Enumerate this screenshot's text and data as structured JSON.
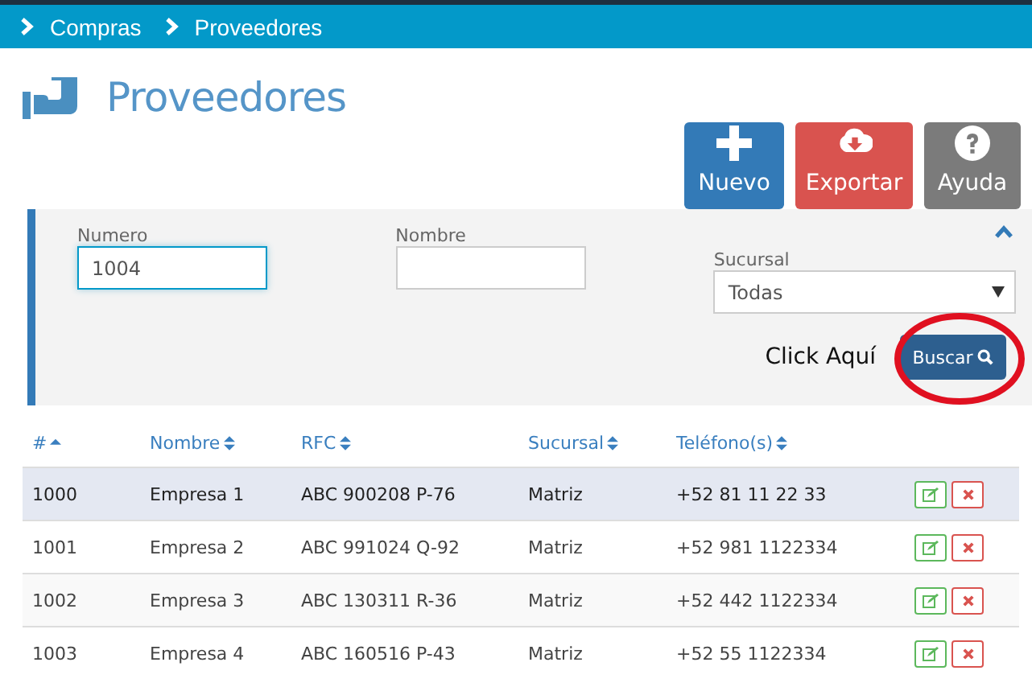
{
  "breadcrumb": [
    "Compras",
    "Proveedores"
  ],
  "page_title": "Proveedores",
  "actions": [
    {
      "kind": "new",
      "label": "Nuevo"
    },
    {
      "kind": "export",
      "label": "Exportar"
    },
    {
      "kind": "help",
      "label": "Ayuda"
    }
  ],
  "filters": {
    "expanded": true,
    "fields": [
      {
        "label": "Numero",
        "value": "1004",
        "focused": true
      },
      {
        "label": "Nombre",
        "focused": false
      }
    ],
    "sucursal": {
      "label": "Sucursal",
      "value": "Todas"
    },
    "hint": "Click Aquí",
    "search_button": "Buscar"
  },
  "table": {
    "columns": [
      {
        "label": "#",
        "sorted": true
      },
      {
        "label": "Nombre",
        "sorted": false
      },
      {
        "label": "RFC",
        "sorted": false
      },
      {
        "label": "Sucursal",
        "sorted": false
      },
      {
        "label": "Teléfono(s)",
        "sorted": false
      }
    ],
    "rows": [
      {
        "cells": [
          "1000",
          "Empresa 1",
          "ABC 900208 P-76",
          "Matriz",
          "+52 81 11 22 33"
        ],
        "selected": true
      },
      {
        "cells": [
          "1001",
          "Empresa 2",
          "ABC 991024 Q-92",
          "Matriz",
          "+52 981 1122334"
        ],
        "selected": false
      },
      {
        "cells": [
          "1002",
          "Empresa 3",
          "ABC 130311 R-36",
          "Matriz",
          "+52 442 1122334"
        ],
        "selected": false
      },
      {
        "cells": [
          "1003",
          "Empresa 4",
          "ABC 160516 P-43",
          "Matriz",
          "+52 55 1122334"
        ],
        "selected": false
      }
    ]
  }
}
